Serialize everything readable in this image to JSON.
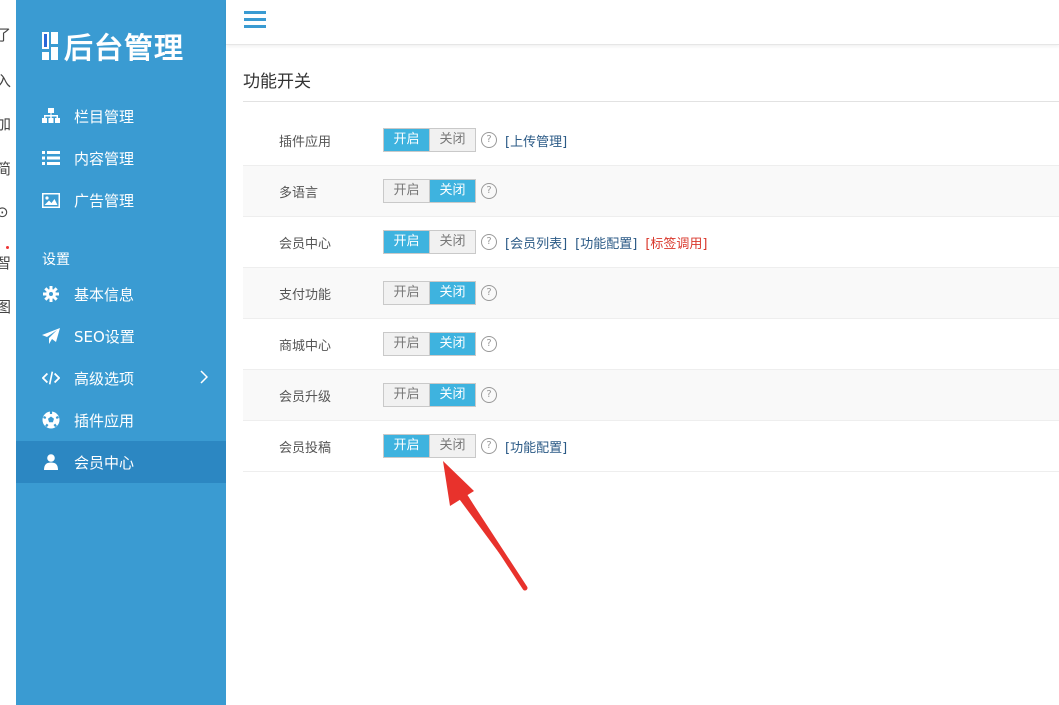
{
  "left_strip": {
    "glyphs": [
      "了",
      "入",
      "加",
      "简",
      "⊙",
      "智",
      "图"
    ]
  },
  "sidebar": {
    "logo_text": "后台管理",
    "items": [
      {
        "label": "栏目管理",
        "icon": "sitemap-icon"
      },
      {
        "label": "内容管理",
        "icon": "list-icon"
      },
      {
        "label": "广告管理",
        "icon": "image-icon"
      }
    ],
    "section_label": "设置",
    "settings_items": [
      {
        "label": "基本信息",
        "icon": "gear-icon"
      },
      {
        "label": "SEO设置",
        "icon": "paper-plane-icon"
      },
      {
        "label": "高级选项",
        "icon": "code-icon",
        "has_submenu": true
      },
      {
        "label": "插件应用",
        "icon": "soccer-ball-icon"
      },
      {
        "label": "会员中心",
        "icon": "user-icon",
        "active": true
      }
    ],
    "colors": {
      "background": "#3a9bd2",
      "active": "#2c87c2"
    }
  },
  "page": {
    "title": "功能开关"
  },
  "toggle_labels": {
    "on": "开启",
    "off": "关闭"
  },
  "rows": [
    {
      "label": "插件应用",
      "state": "on",
      "links": [
        "[上传管理]"
      ]
    },
    {
      "label": "多语言",
      "state": "off",
      "links": []
    },
    {
      "label": "会员中心",
      "state": "on",
      "links": [
        "[会员列表]",
        "[功能配置]",
        "[标签调用]"
      ]
    },
    {
      "label": "支付功能",
      "state": "off",
      "links": []
    },
    {
      "label": "商城中心",
      "state": "off",
      "links": []
    },
    {
      "label": "会员升级",
      "state": "off",
      "links": []
    },
    {
      "label": "会员投稿",
      "state": "on",
      "links": [
        "[功能配置]"
      ]
    }
  ],
  "help_glyph": "?",
  "accent_color": "#3eb3df",
  "annotation_color": "#e8322c"
}
